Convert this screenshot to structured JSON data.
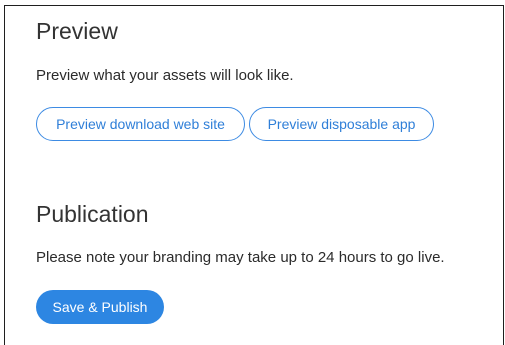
{
  "preview": {
    "title": "Preview",
    "description": "Preview what your assets will look like.",
    "download_site_label": "Preview download web site",
    "disposable_app_label": "Preview disposable app"
  },
  "publication": {
    "title": "Publication",
    "description": "Please note your branding may take up to 24 hours to go live.",
    "save_publish_label": "Save & Publish"
  },
  "colors": {
    "accent": "#2d86e2",
    "outline_border": "#3d8be3",
    "text": "#2b2b2b"
  }
}
